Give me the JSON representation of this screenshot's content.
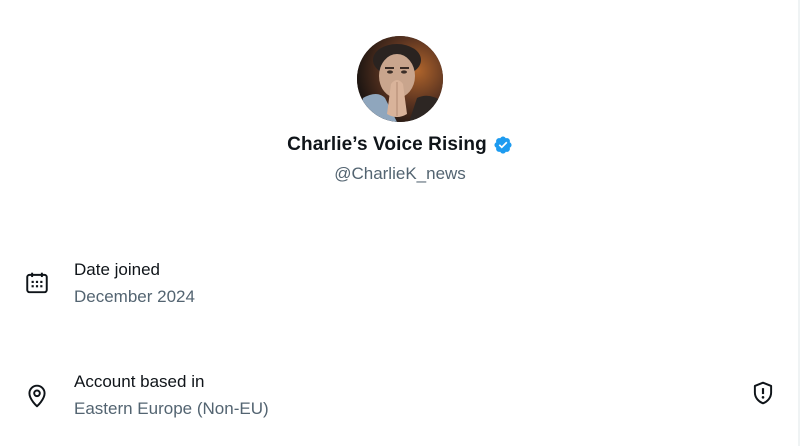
{
  "profile": {
    "display_name": "Charlie’s Voice Rising",
    "handle": "@CharlieK_news",
    "verified": true,
    "verified_color": "#1d9bf0"
  },
  "about": {
    "date_joined": {
      "icon": "calendar-icon",
      "label": "Date joined",
      "value": "December 2024"
    },
    "account_location": {
      "icon": "location-pin-icon",
      "label": "Account based in",
      "value": "Eastern Europe (Non-EU)",
      "action_icon": "shield-alert-icon"
    }
  },
  "colors": {
    "primary_text": "#0f1419",
    "secondary_text": "#536471",
    "background": "#ffffff"
  }
}
